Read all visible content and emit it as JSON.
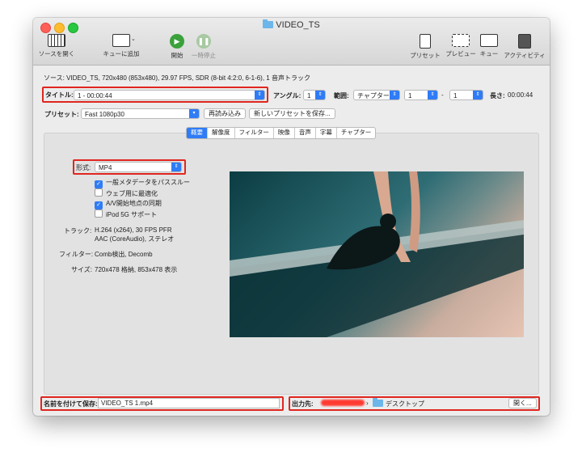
{
  "window": {
    "title": "VIDEO_TS"
  },
  "toolbar": {
    "open_source": "ソースを開く",
    "add_to_queue": "キューに追加",
    "start": "開始",
    "pause": "一時停止",
    "presets": "プリセット",
    "preview": "プレビュー",
    "queue": "キュー",
    "activity": "アクティビティ"
  },
  "source": {
    "label": "ソース:",
    "value": "VIDEO_TS, 720x480 (853x480), 29.97 FPS, SDR (8-bit 4:2:0, 6-1-6), 1 音声トラック"
  },
  "title_row": {
    "title_label": "タイトル:",
    "title_value": "1 - 00:00:44",
    "angle_label": "アングル:",
    "angle_value": "1",
    "range_label": "範囲:",
    "range_type": "チャプター",
    "range_from": "1",
    "range_dash": "-",
    "range_to": "1",
    "duration_label": "長さ:",
    "duration_value": "00:00:44"
  },
  "preset_row": {
    "label": "プリセット:",
    "value": "Fast 1080p30",
    "reload": "再読み込み",
    "new_preset": "新しいプリセットを保存..."
  },
  "tabs": [
    "概要",
    "解像度",
    "フィルター",
    "映像",
    "音声",
    "字幕",
    "チャプター"
  ],
  "summary": {
    "format_label": "形式:",
    "format_value": "MP4",
    "options": [
      {
        "label": "一般メタデータをパススルー",
        "checked": true
      },
      {
        "label": "ウェブ用に最適化",
        "checked": false
      },
      {
        "label": "A/V開始地点の同期",
        "checked": true
      },
      {
        "label": "iPod 5G サポート",
        "checked": false
      }
    ],
    "tracks_label": "トラック:",
    "tracks_line1": "H.264 (x264), 30 FPS PFR",
    "tracks_line2": "AAC (CoreAudio), ステレオ",
    "filters_label": "フィルター:",
    "filters_value": "Comb検出, Decomb",
    "size_label": "サイズ:",
    "size_value": "720x478 格納, 853x478 表示"
  },
  "save": {
    "label": "名前を付けて保存:",
    "value": "VIDEO_TS 1.mp4"
  },
  "output": {
    "label": "出力先:",
    "folder": "デスクトップ",
    "open": "開く..."
  },
  "colors": {
    "accent": "#2f7cf6",
    "highlight": "#e0261f"
  }
}
